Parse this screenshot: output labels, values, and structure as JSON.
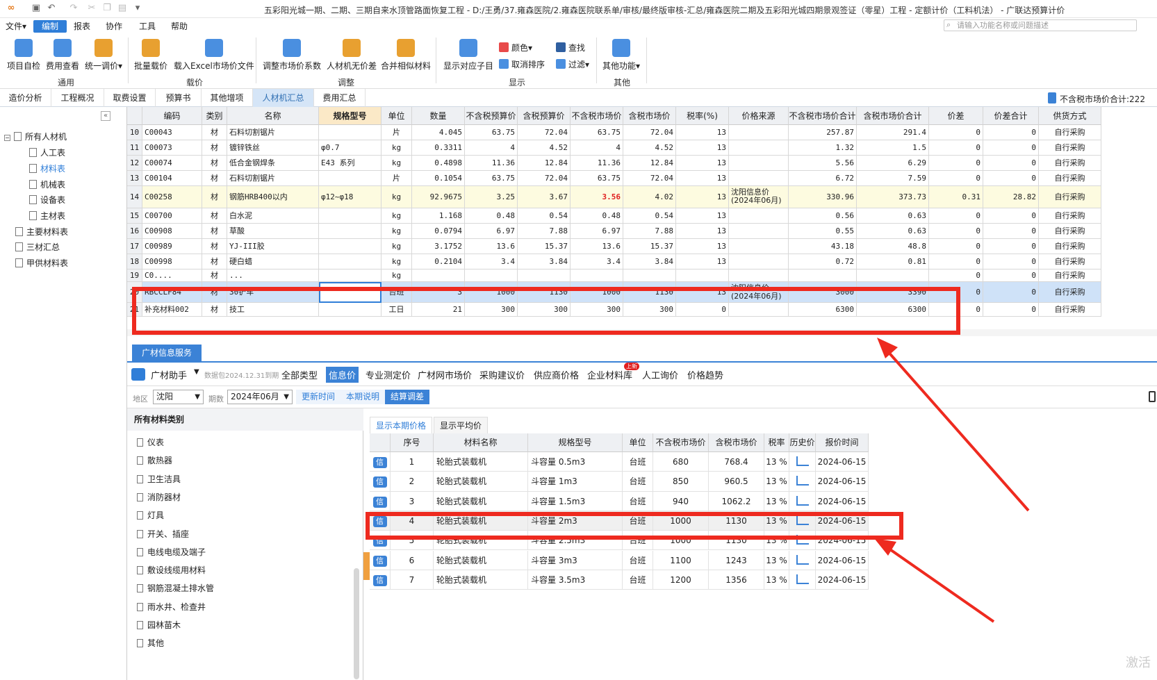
{
  "window": {
    "title": "五彩阳光城一期、二期、三期自来水顶管路面恢复工程 - D:/王勇/37.雍森医院/2.雍森医院联系单/审核/最终版审核-汇总/雍森医院二期及五彩阳光城四期景观签证（零星）工程 - 定额计价（工料机法） - 广联达预算计价"
  },
  "menubar": {
    "items": [
      "文件▾",
      "编制",
      "报表",
      "协作",
      "工具",
      "帮助"
    ],
    "search_placeholder": "请输入功能名称或问题描述"
  },
  "ribbon": {
    "btn1": "项目自检",
    "btn2": "费用查看",
    "btn3": "统一调价▾",
    "grp1": "通用",
    "btn4": "批量载价",
    "btn5": "载入Excel市场价文件",
    "grp2": "载价",
    "btn6": "调整市场价系数",
    "btn7": "人材机无价差",
    "btn8": "合并相似材料",
    "grp3": "调整",
    "btn9": "显示对应子目",
    "s1": "颜色▾",
    "s2": "取消排序",
    "s3": "查找",
    "s4": "过滤▾",
    "grp4": "显示",
    "btn10": "其他功能▾",
    "grp5": "其他"
  },
  "tabs": [
    "造价分析",
    "工程概况",
    "取费设置",
    "预算书",
    "其他增项",
    "人材机汇总",
    "费用汇总"
  ],
  "summary_label": "不含税市场价合计:222",
  "tree": {
    "root": "所有人材机",
    "items": [
      "人工表",
      "材料表",
      "机械表",
      "设备表",
      "主材表"
    ],
    "others": [
      "主要材料表",
      "三材汇总",
      "甲供材料表"
    ]
  },
  "grid": {
    "headers": [
      "编码",
      "类别",
      "名称",
      "规格型号",
      "单位",
      "数量",
      "不含税预算价",
      "含税预算价",
      "不含税市场价",
      "含税市场价",
      "税率(%)",
      "价格来源",
      "不含税市场价合计",
      "含税市场价合计",
      "价差",
      "价差合计",
      "供货方式"
    ],
    "rows": [
      [
        "10",
        "C00043",
        "材",
        "石料切割锯片",
        "",
        "片",
        "4.045",
        "63.75",
        "72.04",
        "63.75",
        "72.04",
        "13",
        "",
        "257.87",
        "291.4",
        "0",
        "0",
        "自行采购"
      ],
      [
        "11",
        "C00073",
        "材",
        "镀锌铁丝",
        "φ0.7",
        "kg",
        "0.3311",
        "4",
        "4.52",
        "4",
        "4.52",
        "13",
        "",
        "1.32",
        "1.5",
        "0",
        "0",
        "自行采购"
      ],
      [
        "12",
        "C00074",
        "材",
        "低合金钢焊条",
        "E43 系列",
        "kg",
        "0.4898",
        "11.36",
        "12.84",
        "11.36",
        "12.84",
        "13",
        "",
        "5.56",
        "6.29",
        "0",
        "0",
        "自行采购"
      ],
      [
        "13",
        "C00104",
        "材",
        "石料切割锯片",
        "",
        "片",
        "0.1054",
        "63.75",
        "72.04",
        "63.75",
        "72.04",
        "13",
        "",
        "6.72",
        "7.59",
        "0",
        "0",
        "自行采购"
      ],
      [
        "14",
        "C00258",
        "材",
        "钢筋HRB400以内",
        "φ12~φ18",
        "kg",
        "92.9675",
        "3.25",
        "3.67",
        "3.56",
        "4.02",
        "13",
        "沈阳信息价\n(2024年06月)",
        "330.96",
        "373.73",
        "0.31",
        "28.82",
        "自行采购"
      ],
      [
        "15",
        "C00700",
        "材",
        "白水泥",
        "",
        "kg",
        "1.168",
        "0.48",
        "0.54",
        "0.48",
        "0.54",
        "13",
        "",
        "0.56",
        "0.63",
        "0",
        "0",
        "自行采购"
      ],
      [
        "16",
        "C00908",
        "材",
        "草酸",
        "",
        "kg",
        "0.0794",
        "6.97",
        "7.88",
        "6.97",
        "7.88",
        "13",
        "",
        "0.55",
        "0.63",
        "0",
        "0",
        "自行采购"
      ],
      [
        "17",
        "C00989",
        "材",
        "YJ-III胶",
        "",
        "kg",
        "3.1752",
        "13.6",
        "15.37",
        "13.6",
        "15.37",
        "13",
        "",
        "43.18",
        "48.8",
        "0",
        "0",
        "自行采购"
      ],
      [
        "18",
        "C00998",
        "材",
        "硬白蜡",
        "",
        "kg",
        "0.2104",
        "3.4",
        "3.84",
        "3.4",
        "3.84",
        "13",
        "",
        "0.72",
        "0.81",
        "0",
        "0",
        "自行采购"
      ],
      [
        "19",
        "C0....",
        "材",
        "...",
        "",
        "kg",
        "",
        "",
        "",
        "",
        "",
        "",
        "",
        "",
        "",
        "0",
        "0",
        "自行采购"
      ],
      [
        "20",
        "RBCCLF84",
        "材",
        "30铲车",
        "",
        "台班",
        "3",
        "1000",
        "1130",
        "1000",
        "1130",
        "13",
        "沈阳信息价\n(2024年06月)",
        "3000",
        "3390",
        "0",
        "0",
        "自行采购"
      ],
      [
        "21",
        "补充材料002",
        "材",
        "技工",
        "",
        "工日",
        "21",
        "300",
        "300",
        "300",
        "300",
        "0",
        "",
        "6300",
        "6300",
        "0",
        "0",
        "自行采购"
      ]
    ]
  },
  "info": {
    "tab": "广材信息服务",
    "helper": "广材助手",
    "helper_sub": "数据包2024.12.31到期",
    "tabs": [
      "全部类型",
      "信息价",
      "专业测定价",
      "广材网市场价",
      "采购建议价",
      "供应商价格",
      "企业材料库",
      "人工询价",
      "价格趋势"
    ],
    "badge": "上新",
    "region_label": "地区",
    "region": "沈阳",
    "period_label": "期数",
    "period": "2024年06月",
    "btn_refresh": "更新时间",
    "btn_note": "本期说明",
    "btn_adjust": "结算调差",
    "cat_head": "所有材料类别",
    "cats": [
      "仪表",
      "散热器",
      "卫生洁具",
      "消防器材",
      "灯具",
      "开关、插座",
      "电线电缆及端子",
      "敷设线缆用材料",
      "钢筋混凝土排水管",
      "雨水井、检查井",
      "园林苗木",
      "其他"
    ],
    "subtabs": [
      "显示本期价格",
      "显示平均价"
    ],
    "pheaders": [
      "序号",
      "材料名称",
      "规格型号",
      "单位",
      "不含税市场价",
      "含税市场价",
      "税率",
      "历史价",
      "报价时间"
    ],
    "xin": "信",
    "prows": [
      [
        "1",
        "轮胎式装载机",
        "斗容量 0.5m3",
        "台班",
        "680",
        "768.4",
        "13 %",
        "2024-06-15"
      ],
      [
        "2",
        "轮胎式装载机",
        "斗容量 1m3",
        "台班",
        "850",
        "960.5",
        "13 %",
        "2024-06-15"
      ],
      [
        "3",
        "轮胎式装载机",
        "斗容量 1.5m3",
        "台班",
        "940",
        "1062.2",
        "13 %",
        "2024-06-15"
      ],
      [
        "4",
        "轮胎式装载机",
        "斗容量 2m3",
        "台班",
        "1000",
        "1130",
        "13 %",
        "2024-06-15"
      ],
      [
        "5",
        "轮胎式装载机",
        "斗容量 2.5m3",
        "台班",
        "1000",
        "1130",
        "13 %",
        "2024-06-15"
      ],
      [
        "6",
        "轮胎式装载机",
        "斗容量 3m3",
        "台班",
        "1100",
        "1243",
        "13 %",
        "2024-06-15"
      ],
      [
        "7",
        "轮胎式装载机",
        "斗容量 3.5m3",
        "台班",
        "1200",
        "1356",
        "13 %",
        "2024-06-15"
      ]
    ]
  },
  "watermark": "激活"
}
